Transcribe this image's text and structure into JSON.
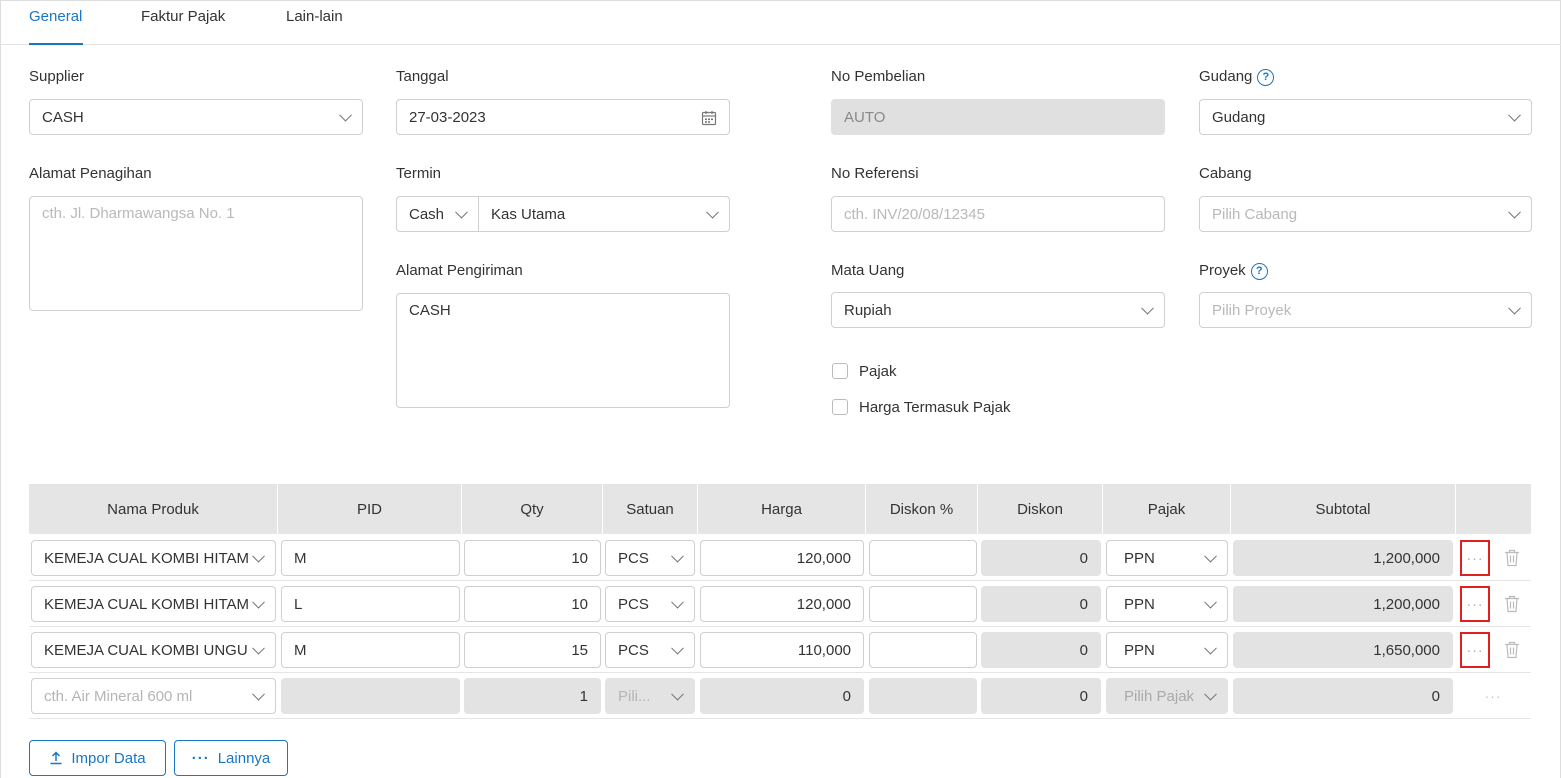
{
  "tabs": [
    "General",
    "Faktur Pajak",
    "Lain-lain"
  ],
  "form": {
    "supplier": {
      "label": "Supplier",
      "value": "CASH"
    },
    "tanggal": {
      "label": "Tanggal",
      "value": "27-03-2023"
    },
    "no_pembelian": {
      "label": "No Pembelian",
      "value": "AUTO"
    },
    "gudang": {
      "label": "Gudang",
      "value": "Gudang"
    },
    "alamat_penagihan": {
      "label": "Alamat Penagihan",
      "placeholder": "cth. Jl. Dharmawangsa No. 1"
    },
    "termin": {
      "label": "Termin",
      "type": "Cash",
      "account": "Kas Utama"
    },
    "no_referensi": {
      "label": "No Referensi",
      "placeholder": "cth. INV/20/08/12345"
    },
    "cabang": {
      "label": "Cabang",
      "placeholder": "Pilih Cabang"
    },
    "alamat_pengiriman": {
      "label": "Alamat Pengiriman",
      "value": "CASH"
    },
    "mata_uang": {
      "label": "Mata Uang",
      "value": "Rupiah"
    },
    "proyek": {
      "label": "Proyek",
      "placeholder": "Pilih Proyek"
    },
    "pajak": {
      "label": "Pajak",
      "checked": false
    },
    "harga_termasuk_pajak": {
      "label": "Harga Termasuk Pajak",
      "checked": false
    }
  },
  "table": {
    "headers": [
      "Nama Produk",
      "PID",
      "Qty",
      "Satuan",
      "Harga",
      "Diskon %",
      "Diskon",
      "Pajak",
      "Subtotal"
    ],
    "rows": [
      {
        "produk": "KEMEJA CUAL KOMBI HITAM",
        "pid": "M",
        "qty": "10",
        "satuan": "PCS",
        "harga": "120,000",
        "diskon_pct": "",
        "diskon": "0",
        "pajak": "PPN",
        "subtotal": "1,200,000"
      },
      {
        "produk": "KEMEJA CUAL KOMBI HITAM",
        "pid": "L",
        "qty": "10",
        "satuan": "PCS",
        "harga": "120,000",
        "diskon_pct": "",
        "diskon": "0",
        "pajak": "PPN",
        "subtotal": "1,200,000"
      },
      {
        "produk": "KEMEJA CUAL KOMBI UNGU",
        "pid": "M",
        "qty": "15",
        "satuan": "PCS",
        "harga": "110,000",
        "diskon_pct": "",
        "diskon": "0",
        "pajak": "PPN",
        "subtotal": "1,650,000"
      }
    ],
    "new_row": {
      "produk_placeholder": "cth. Air Mineral 600 ml",
      "qty": "1",
      "satuan_placeholder": "Pili...",
      "harga": "0",
      "diskon": "0",
      "pajak_placeholder": "Pilih Pajak",
      "subtotal": "0"
    },
    "more_glyph": "···"
  },
  "buttons": {
    "impor": "Impor Data",
    "lainnya": "Lainnya"
  },
  "colors": {
    "accent": "#1877c6",
    "highlight": "#e02020",
    "header_bg": "#e5e5e5"
  }
}
